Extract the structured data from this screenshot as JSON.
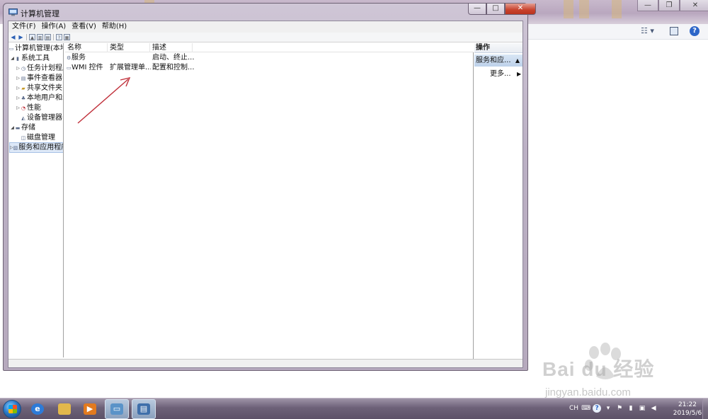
{
  "window": {
    "title": "计算机管理",
    "menu": [
      "文件(F)",
      "操作(A)",
      "查看(V)",
      "帮助(H)"
    ],
    "caption_buttons": {
      "minimize": "—",
      "maximize": "□",
      "close": "✕"
    }
  },
  "tree": {
    "items": [
      {
        "label": "计算机管理(本地",
        "icon": "computer-icon",
        "expander": ""
      },
      {
        "label": "系统工具",
        "icon": "tools-icon",
        "expander": "◢"
      },
      {
        "label": "任务计划程序",
        "icon": "clock-icon",
        "expander": "▷"
      },
      {
        "label": "事件查看器",
        "icon": "event-viewer-icon",
        "expander": "▷"
      },
      {
        "label": "共享文件夹",
        "icon": "shared-folder-icon",
        "expander": "▷"
      },
      {
        "label": "本地用户和组",
        "icon": "users-icon",
        "expander": "▷"
      },
      {
        "label": "性能",
        "icon": "performance-icon",
        "expander": "▷"
      },
      {
        "label": "设备管理器",
        "icon": "device-manager-icon",
        "expander": ""
      },
      {
        "label": "存储",
        "icon": "storage-icon",
        "expander": "◢"
      },
      {
        "label": "磁盘管理",
        "icon": "disk-icon",
        "expander": ""
      },
      {
        "label": "服务和应用程序",
        "icon": "services-apps-icon",
        "expander": "▷"
      }
    ]
  },
  "list": {
    "columns": [
      "名称",
      "类型",
      "描述"
    ],
    "rows": [
      {
        "name": "服务",
        "type": "",
        "description": "启动、终止..."
      },
      {
        "name": "WMI 控件",
        "type": "扩展管理单...",
        "description": "配置和控制..."
      }
    ]
  },
  "actions": {
    "title": "操作",
    "group": "服务和应...",
    "more": "更多..."
  },
  "taskbar": {
    "tray": {
      "lang": "CH",
      "help": "?"
    },
    "clock": {
      "time": "21:22",
      "date": "2019/5/6"
    }
  },
  "watermark": {
    "brand": "Bai du 经验",
    "url": "jingyan.baidu.com"
  },
  "colors": {
    "accent": "#2d66c8",
    "selection": "#dde8f7",
    "annotation_arrow": "#c0303a",
    "close_button": "#c8412c"
  }
}
